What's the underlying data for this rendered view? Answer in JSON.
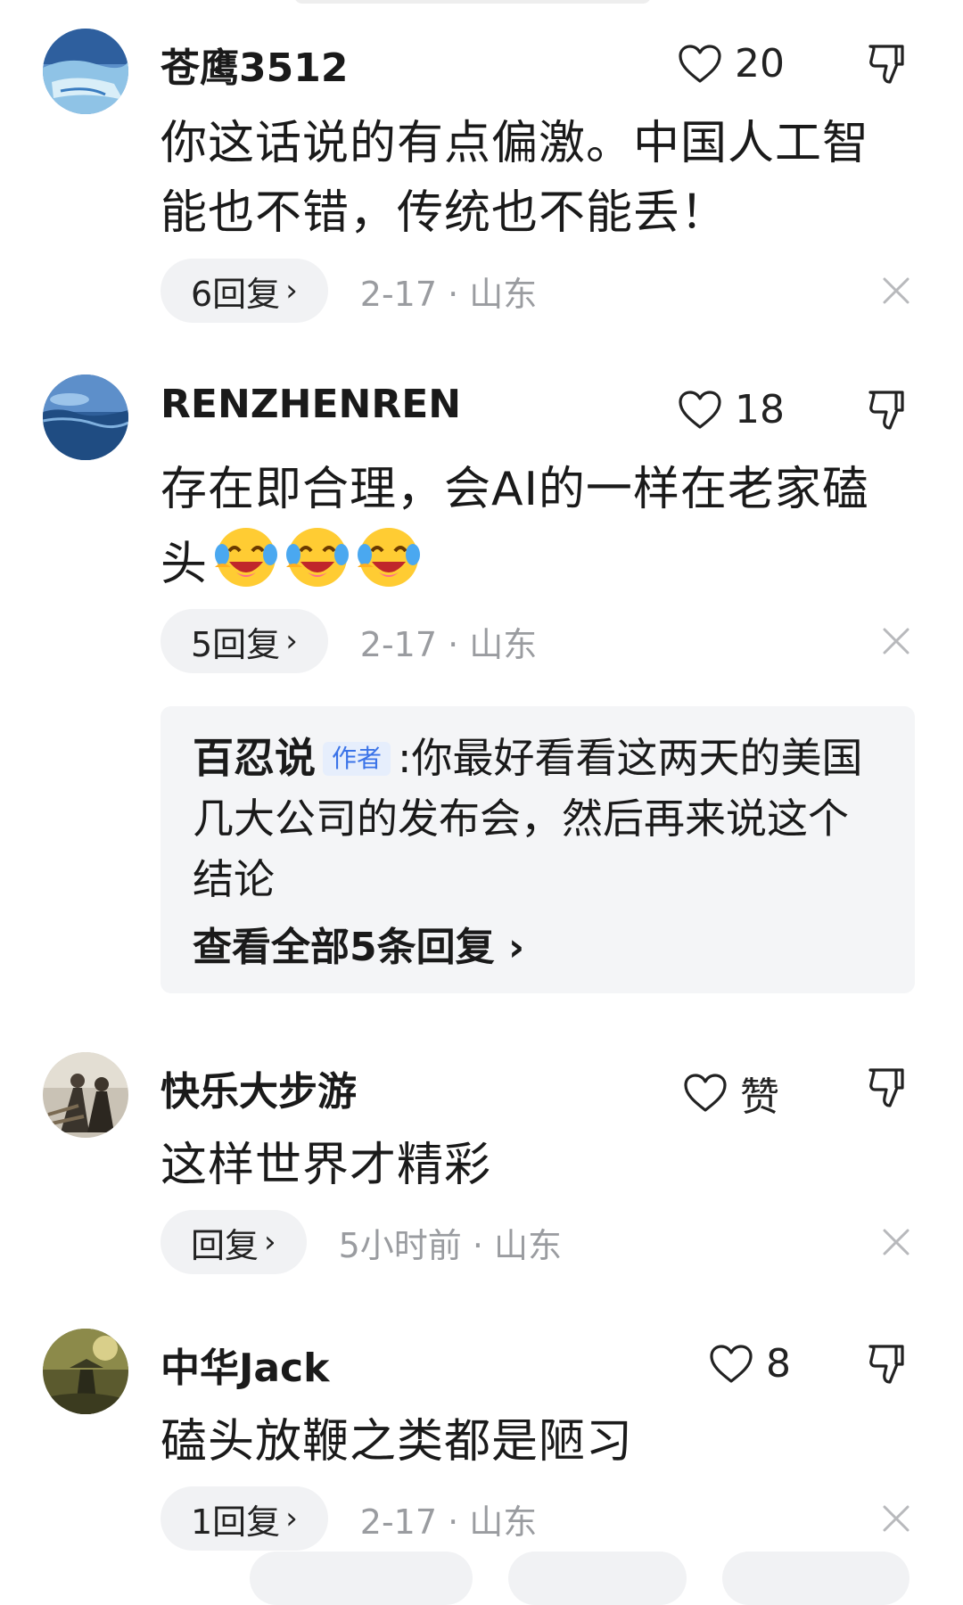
{
  "comments": [
    {
      "username": "苍鹰3512",
      "like_count": "20",
      "content": "你这话说的有点偏激。中国人工智能也不错，传统也不能丢！",
      "reply_label": "6回复",
      "meta": "2-17 · 山东"
    },
    {
      "username": "RENZHENREN",
      "like_count": "18",
      "content": "存在即合理，会AI的一样在老家磕头",
      "emoji_icon": "laughing-crying-emoji",
      "reply_label": "5回复",
      "meta": "2-17 · 山东",
      "featured_reply": {
        "author": "百忍说",
        "badge": "作者",
        "separator": ":",
        "text": "你最好看看这两天的美国几大公司的发布会，然后再来说这个结论",
        "view_all": "查看全部5条回复"
      }
    },
    {
      "username": "快乐大步游",
      "like_count": "赞",
      "content": "这样世界才精彩",
      "reply_label": "回复",
      "meta": "5小时前 · 山东"
    },
    {
      "username": "中华Jack",
      "like_count": "8",
      "content": "磕头放鞭之类都是陋习",
      "reply_label": "1回复",
      "meta": "2-17 · 山东"
    }
  ],
  "icons": {
    "like": "heart-outline-icon",
    "dislike": "thumbs-down-icon",
    "dismiss": "close-icon",
    "chevron": "chevron-right-icon"
  },
  "colors": {
    "meta_text": "#9a9ca0",
    "pill_bg": "#f1f2f4",
    "badge_text": "#3a73e8",
    "badge_bg": "#e6eefc"
  }
}
